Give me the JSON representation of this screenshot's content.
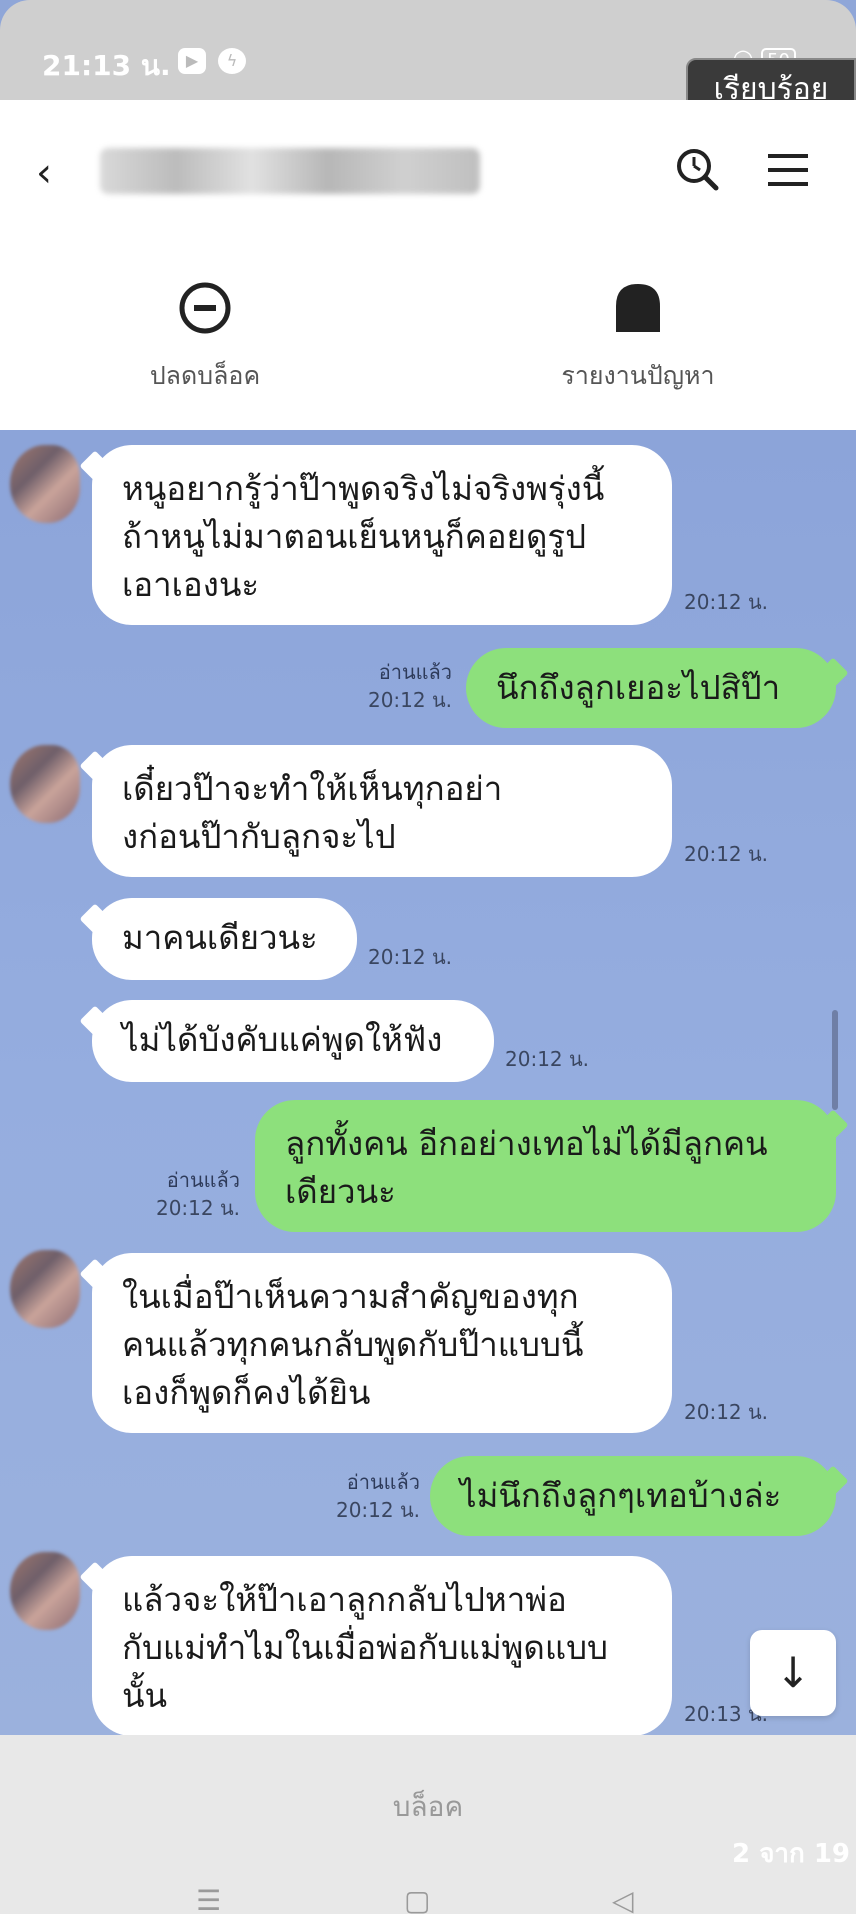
{
  "status": {
    "time": "21:13 น.",
    "battery": "50",
    "done_label": "เรียบร้อย"
  },
  "header": {
    "unblock_label": "ปลดบล็อค",
    "report_label": "รายงานปัญหา"
  },
  "messages": [
    {
      "side": "in",
      "text": "หนูอยากรู้ว่าป๊าพูดจริงไม่จริงพรุ่งนี้\nถ้าหนูไม่มาตอนเย็นหนูก็คอยดูรูป\nเอาเองนะ",
      "time": "20:12 น."
    },
    {
      "side": "out",
      "text": "นึกถึงลูกเยอะไปสิป๊า",
      "read": "อ่านแล้ว",
      "time": "20:12 น."
    },
    {
      "side": "in",
      "text": "เดี๋ยวป๊าจะทำให้เห็นทุกอย่า\nงก่อนป๊ากับลูกจะไป",
      "time": "20:12 น."
    },
    {
      "side": "in",
      "text": "มาคนเดียวนะ",
      "time": "20:12 น."
    },
    {
      "side": "in",
      "text": "ไม่ได้บังคับแค่พูดให้ฟัง",
      "time": "20:12 น."
    },
    {
      "side": "out",
      "text": "ลูกทั้งคน อีกอย่างเทอไม่ได้มีลูกคน\nเดียวนะ",
      "read": "อ่านแล้ว",
      "time": "20:12 น."
    },
    {
      "side": "in",
      "text": "ในเมื่อป๊าเห็นความสำคัญของทุก\nคนแล้วทุกคนกลับพูดกับป๊าแบบนี้\nเองก็พูดก็คงได้ยิน",
      "time": "20:12 น."
    },
    {
      "side": "out",
      "text": "ไม่นึกถึงลูกๆเทอบ้างล่ะ",
      "read": "อ่านแล้ว",
      "time": "20:12 น."
    },
    {
      "side": "in",
      "text": "แล้วจะให้ป๊าเอาลูกกลับไปหาพ่อ\nกับแม่ทำไมในเมื่อพ่อกับแม่พูดแบบ\nนั้น",
      "time": "20:13 น."
    }
  ],
  "bottom": {
    "block_label": "บล็อค",
    "page_count": "2 จาก 19"
  },
  "colors": {
    "chat_bg": "#8fa6d8",
    "outgoing_bubble": "#8de07c",
    "incoming_bubble": "#ffffff"
  }
}
